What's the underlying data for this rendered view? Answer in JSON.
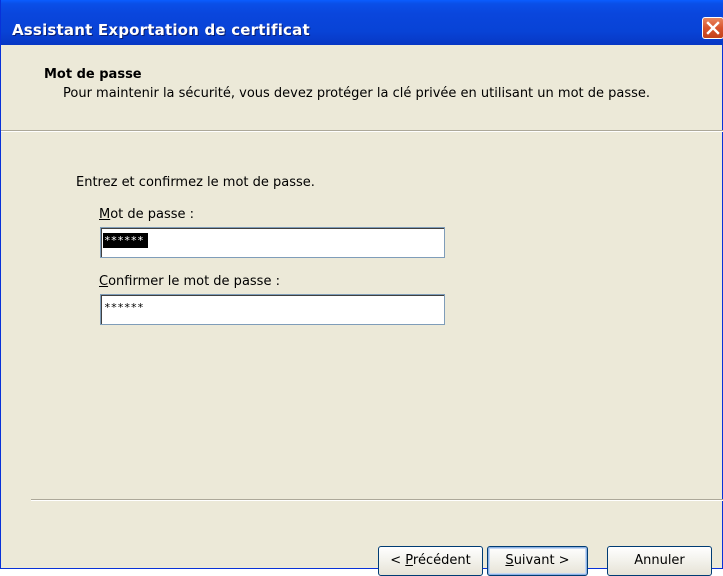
{
  "window": {
    "title": "Assistant Exportation de certificat"
  },
  "header": {
    "title": "Mot de passe",
    "description": "Pour maintenir la sécurité, vous devez protéger la clé privée en utilisant un mot de passe."
  },
  "body": {
    "prompt": "Entrez et confirmez le mot de passe.",
    "password": {
      "label_accel": "M",
      "label_rest": "ot de passe :",
      "value": "******"
    },
    "confirm": {
      "label_accel": "C",
      "label_rest": "onfirmer le mot de passe :",
      "value": "******"
    }
  },
  "buttons": {
    "back_prefix": "< ",
    "back_accel": "P",
    "back_rest": "récédent",
    "next_accel": "S",
    "next_rest": "uivant >",
    "cancel": "Annuler"
  },
  "colors": {
    "titlebar": "#0a46dd",
    "dialog_bg": "#ece9d8",
    "close_button": "#d8532c",
    "textbox_border": "#7f9db9",
    "button_border": "#003c74"
  },
  "icons": {
    "close": "close-icon"
  }
}
